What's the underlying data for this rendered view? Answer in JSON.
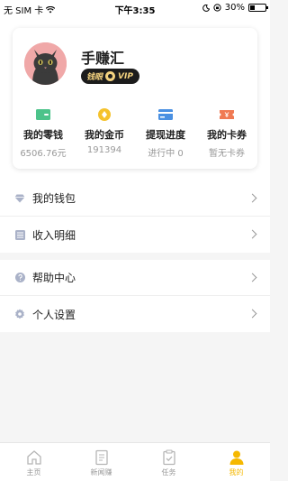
{
  "status_bar": {
    "carrier": "无 SIM 卡",
    "time": "下午3:35",
    "battery": "30%",
    "battery_level": 0.3
  },
  "profile": {
    "username": "手赚汇",
    "vip_label": "钱眼",
    "vip_suffix": "VIP"
  },
  "stats": [
    {
      "label": "我的零钱",
      "value": "6506.76元",
      "icon": "wallet-icon",
      "color": "#4cc38a"
    },
    {
      "label": "我的金币",
      "value": "191394",
      "icon": "coin-icon",
      "color": "#f5c22c"
    },
    {
      "label": "提现进度",
      "value": "进行中 0",
      "icon": "card-icon",
      "color": "#4a90e2"
    },
    {
      "label": "我的卡券",
      "value": "暂无卡券",
      "icon": "coupon-icon",
      "color": "#f07a53"
    }
  ],
  "menu": {
    "group1": [
      {
        "label": "我的钱包",
        "icon": "diamond-icon"
      },
      {
        "label": "收入明细",
        "icon": "list-icon"
      }
    ],
    "group2": [
      {
        "label": "帮助中心",
        "icon": "help-icon"
      },
      {
        "label": "个人设置",
        "icon": "settings-icon"
      }
    ]
  },
  "tabs": [
    {
      "label": "主页",
      "icon": "home-icon"
    },
    {
      "label": "新闻赚",
      "icon": "news-icon"
    },
    {
      "label": "任务",
      "icon": "task-icon"
    },
    {
      "label": "我的",
      "icon": "profile-icon"
    }
  ],
  "colors": {
    "accent": "#f5b800",
    "avatar_bg": "#f0a8a8"
  }
}
